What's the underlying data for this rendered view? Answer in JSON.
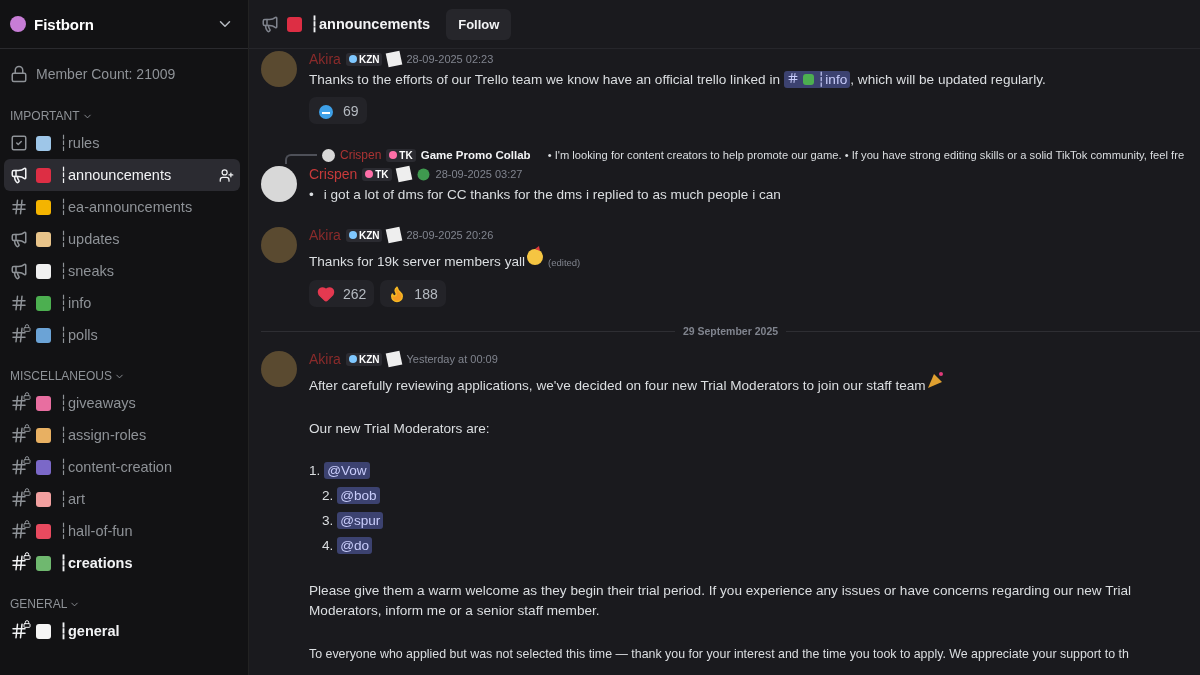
{
  "server": {
    "name": "Fistborn",
    "member_count": "Member Count: 21009"
  },
  "sidebar": {
    "sections": [
      {
        "title": "IMPORTANT",
        "channels": [
          {
            "kind": "rules",
            "name": "┆rules",
            "color": "#9ec6e8",
            "locked": false,
            "selected": false,
            "unread": false
          },
          {
            "kind": "announcement",
            "name": "┆announcements",
            "color": "#dd2e44",
            "locked": false,
            "selected": true,
            "unread": false
          },
          {
            "kind": "text",
            "name": "┆ea-announcements",
            "color": "#f4b400",
            "locked": false,
            "selected": false,
            "unread": false
          },
          {
            "kind": "announcement",
            "name": "┆updates",
            "color": "#e8c48a",
            "locked": false,
            "selected": false,
            "unread": false
          },
          {
            "kind": "announcement",
            "name": "┆sneaks",
            "color": "#f0f0f0",
            "locked": false,
            "selected": false,
            "unread": false
          },
          {
            "kind": "text",
            "name": "┆info",
            "color": "#4caf50",
            "locked": false,
            "selected": false,
            "unread": false
          },
          {
            "kind": "text",
            "name": "┆polls",
            "color": "#6ba3d6",
            "locked": true,
            "selected": false,
            "unread": false
          }
        ]
      },
      {
        "title": "MISCELLANEOUS",
        "channels": [
          {
            "kind": "text",
            "name": "┆giveaways",
            "color": "#e86ea0",
            "locked": true,
            "selected": false,
            "unread": false
          },
          {
            "kind": "text",
            "name": "┆assign-roles",
            "color": "#e8b062",
            "locked": true,
            "selected": false,
            "unread": false
          },
          {
            "kind": "text",
            "name": "┆content-creation",
            "color": "#7b68c8",
            "locked": true,
            "selected": false,
            "unread": false
          },
          {
            "kind": "text",
            "name": "┆art",
            "color": "#f2a0a0",
            "locked": true,
            "selected": false,
            "unread": false
          },
          {
            "kind": "text",
            "name": "┆hall-of-fun",
            "color": "#e84a5f",
            "locked": true,
            "selected": false,
            "unread": false
          },
          {
            "kind": "text",
            "name": "┆creations",
            "color": "#6fb86f",
            "locked": true,
            "selected": false,
            "unread": true
          }
        ]
      },
      {
        "title": "GENERAL",
        "channels": [
          {
            "kind": "text",
            "name": "┆general",
            "color": "#f5f5f5",
            "locked": true,
            "selected": false,
            "unread": true
          }
        ]
      }
    ]
  },
  "header": {
    "channel": "┆announcements",
    "color": "#dd2e44",
    "button": "Follow"
  },
  "messages": [
    {
      "kind": "message",
      "author": "Akira",
      "tag": "KZN",
      "time": "28-09-2025 02:23",
      "body": [
        {
          "kind": "text",
          "text": "Thanks to the efforts of our Trello team we know have an official trello linked in "
        },
        {
          "kind": "channel",
          "text": "┆info"
        },
        {
          "kind": "text",
          "text": ", which will be updated regularly."
        }
      ],
      "reactions": [
        {
          "kind": "blue-face",
          "count": "69"
        }
      ]
    },
    {
      "kind": "reply",
      "reply_author": "Crispen",
      "reply_tag": "TK",
      "reply_text": "Game Promo Collab",
      "reply_preview": "• I'm looking for content creators to help promote our game.  • If you have strong editing skills or a solid TikTok community, feel fre",
      "author": "Crispen",
      "tag": "TK",
      "time": "28-09-2025 03:27",
      "bullet_mark": "•",
      "bullet": "i got a lot of dms for CC thanks for the dms i replied to as much people i can"
    },
    {
      "kind": "message",
      "author": "Akira",
      "tag": "KZN",
      "time": "28-09-2025 20:26",
      "body": [
        {
          "kind": "text",
          "text": "Thanks for 19k server members yall"
        },
        {
          "kind": "party-face"
        },
        {
          "kind": "edited",
          "text": "(edited)"
        }
      ],
      "reactions": [
        {
          "kind": "heart",
          "count": "262"
        },
        {
          "kind": "fire",
          "count": "188"
        }
      ]
    },
    {
      "kind": "divider",
      "text": "29 September 2025"
    },
    {
      "kind": "post",
      "author": "Akira",
      "tag": "KZN",
      "time": "Yesterday at 00:09",
      "intro": "After carefully reviewing applications, we've decided on four new Trial Moderators to join our staff team",
      "list_title": "Our new Trial Moderators are:",
      "list": [
        {
          "number": "1.",
          "mention": "@Vow"
        },
        {
          "number": "2.",
          "mention": "@bob"
        },
        {
          "number": "3.",
          "mention": "@spur"
        },
        {
          "number": "4.",
          "mention": "@do"
        }
      ],
      "paragraphs": [
        "Please give them a warm welcome as they begin their trial period. If you experience any issues or have concerns regarding our new Trial Moderators, inform me or a senior staff member.",
        "To everyone who applied but was not selected this time — thank you for your interest and the time you took to apply. We appreciate your support to th"
      ]
    }
  ]
}
